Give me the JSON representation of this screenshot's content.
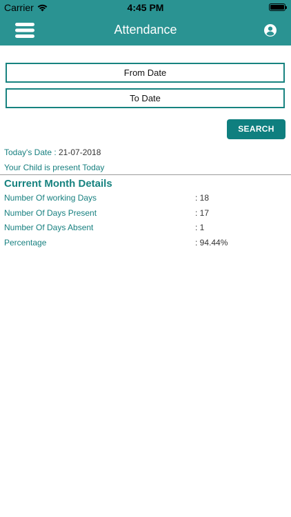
{
  "status_bar": {
    "carrier": "Carrier",
    "time": "4:45 PM"
  },
  "nav": {
    "title": "Attendance",
    "menu_icon": "hamburger-menu-icon",
    "profile_icon": "account-circle-icon"
  },
  "filters": {
    "from_date_label": "From Date",
    "to_date_label": "To Date",
    "search_label": "SEARCH"
  },
  "today": {
    "label": "Today's Date : ",
    "value": "21-07-2018",
    "status_message": "Your Child is present Today"
  },
  "current_month": {
    "title": "Current Month Details",
    "rows": [
      {
        "label": "Number Of working Days",
        "value": ": 18"
      },
      {
        "label": "Number Of Days Present",
        "value": ": 17"
      },
      {
        "label": "Number Of Days Absent",
        "value": ": 1"
      },
      {
        "label": "Percentage",
        "value": ": 94.44%"
      }
    ]
  },
  "colors": {
    "primary": "#2a9392",
    "button": "#0f7f7f",
    "text_accent": "#167f7f"
  }
}
